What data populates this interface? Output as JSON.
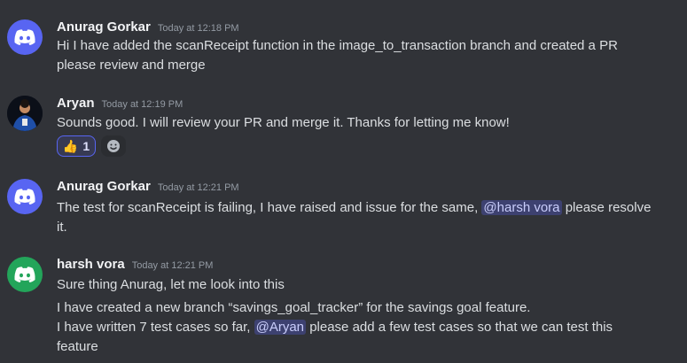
{
  "messages": [
    {
      "author": "Anurag Gorkar",
      "timestamp": "Today at 12:18 PM",
      "lines": [
        "Hi I have added the scanReceipt function in the image_to_transaction branch and created a PR",
        "please review and merge"
      ]
    },
    {
      "author": "Aryan",
      "timestamp": "Today at 12:19 PM",
      "lines": [
        "Sounds good. I will review your PR and merge it. Thanks for letting me know!"
      ],
      "reaction": {
        "emoji": "👍",
        "count": "1"
      }
    },
    {
      "author": "Anurag Gorkar",
      "timestamp": "Today at 12:21 PM",
      "line1_before": "The test for scanReceipt is failing, I have raised and issue for the same, ",
      "mention": "@harsh vora",
      "line1_after": " please resolve",
      "line2": "it."
    },
    {
      "author": "harsh vora",
      "timestamp": "Today at 12:21 PM",
      "line1": "Sure thing Anurag, let me look into this",
      "line2": "I have created a new branch “savings_goal_tracker” for the savings goal feature.",
      "line3_before": "I have written 7 test cases so far, ",
      "mention": "@Aryan",
      "line3_after": " please add a few test cases so that we can test this",
      "line4": "feature"
    }
  ],
  "colors": {
    "background": "#313338",
    "blurple": "#5865f2",
    "green": "#23a55a",
    "mention_bg": "rgba(88,101,242,0.3)"
  },
  "icons": {
    "discord_avatar": "discord-logo-icon",
    "add_reaction": "smiley-icon"
  }
}
